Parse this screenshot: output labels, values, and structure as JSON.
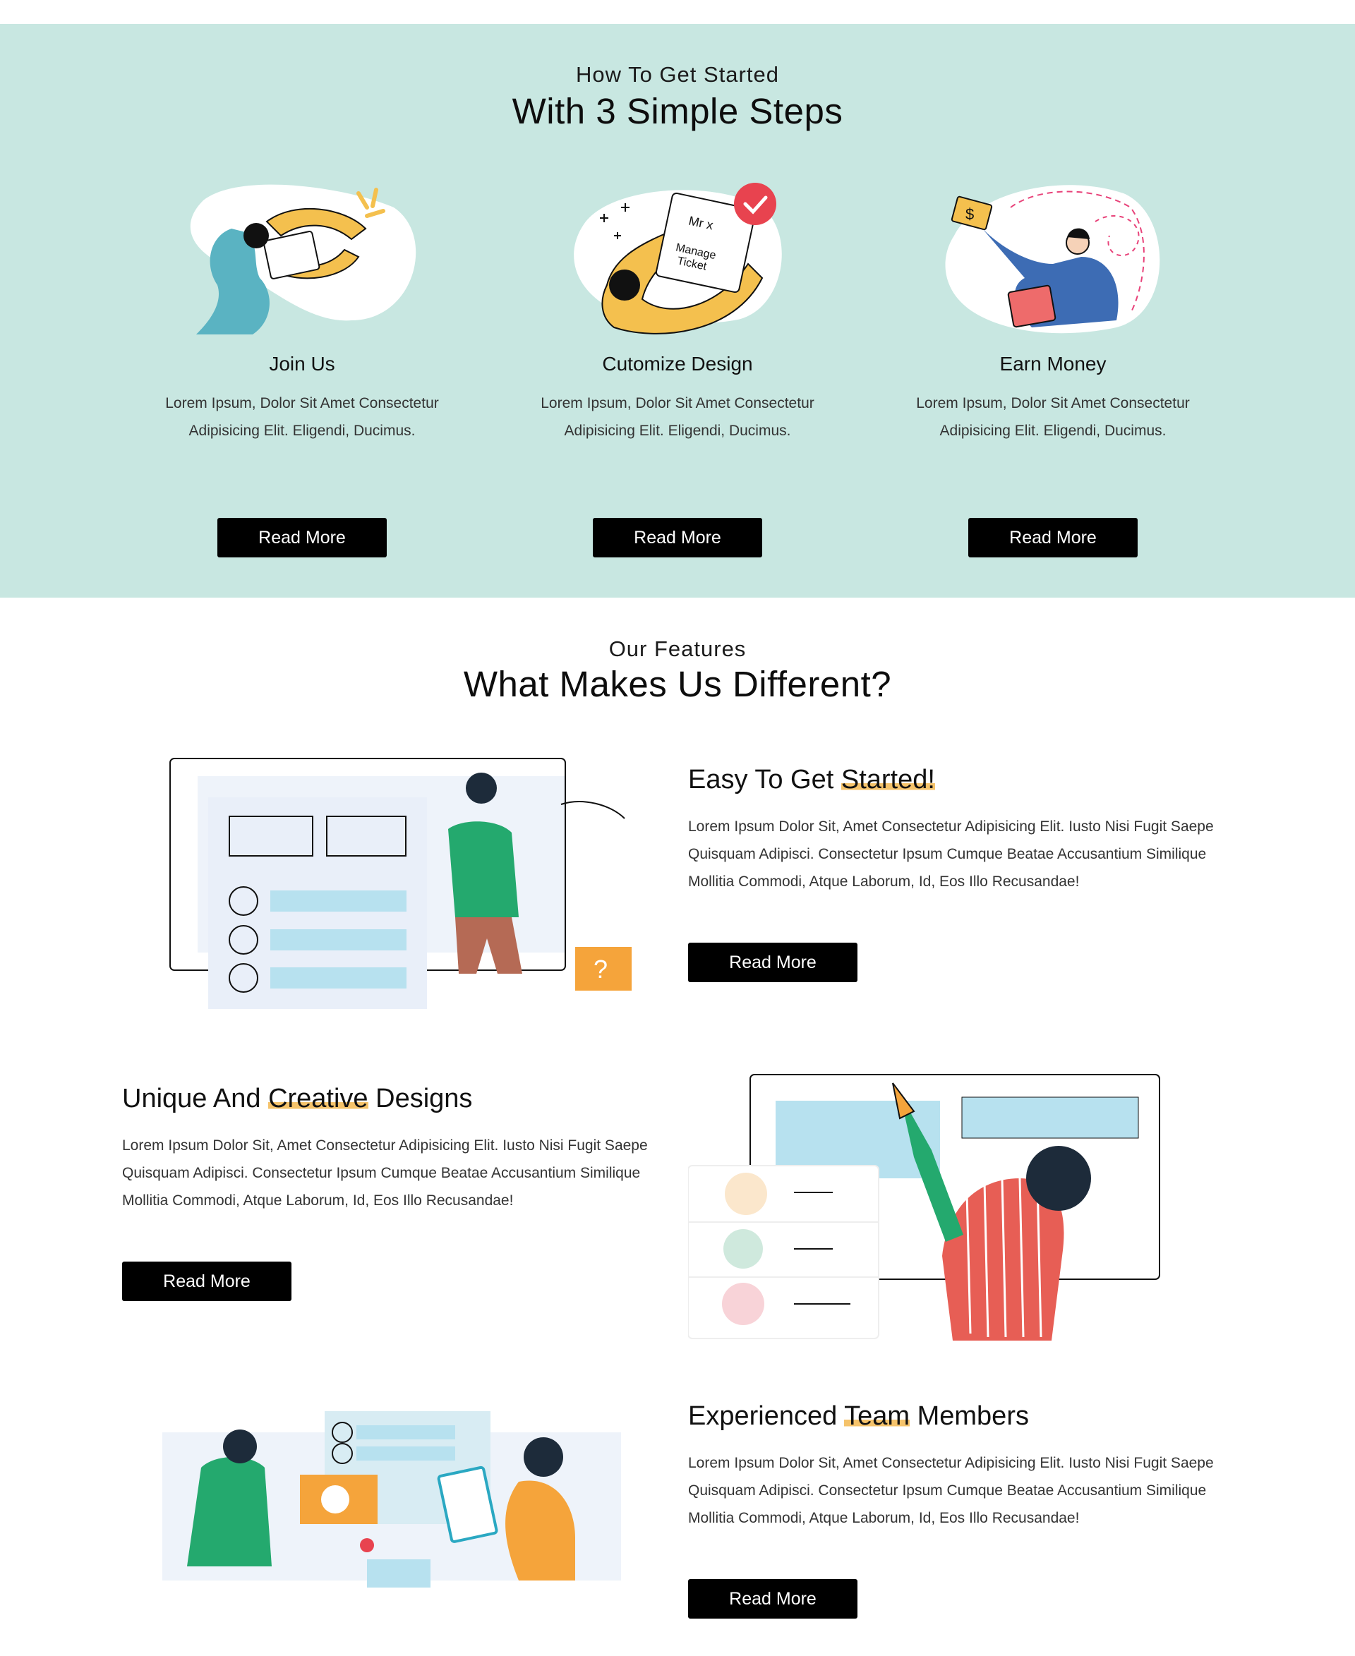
{
  "steps_section": {
    "kicker": "How To Get Started",
    "heading": "With 3 Simple Steps",
    "background": "#c8e7e1",
    "items": [
      {
        "title": "Join Us",
        "text": "Lorem Ipsum, Dolor Sit Amet Consectetur Adipisicing Elit. Eligendi, Ducimus.",
        "button": "Read More",
        "icon": "join-illustration"
      },
      {
        "title": "Cutomize Design",
        "text": "Lorem Ipsum, Dolor Sit Amet Consectetur Adipisicing Elit. Eligendi, Ducimus.",
        "button": "Read More",
        "icon": "ticket-illustration",
        "ticket_line1": "Mr x",
        "ticket_line2": "Manage",
        "ticket_line3": "Ticket"
      },
      {
        "title": "Earn Money",
        "text": "Lorem Ipsum, Dolor Sit Amet Consectetur Adipisicing Elit. Eligendi, Ducimus.",
        "button": "Read More",
        "icon": "money-illustration",
        "money_symbol": "$"
      }
    ]
  },
  "features_section": {
    "kicker": "Our Features",
    "heading": "What Makes Us Different?",
    "highlight_color": "#f5c36b",
    "items": [
      {
        "title_before": "Easy To Get ",
        "title_highlight": "Started!",
        "title_after": "",
        "text": "Lorem Ipsum Dolor Sit, Amet Consectetur Adipisicing Elit. Iusto Nisi Fugit Saepe Quisquam Adipisci. Consectetur Ipsum Cumque Beatae Accusantium Similique Mollitia Commodi, Atque Laborum, Id, Eos Illo Recusandae!",
        "button": "Read More",
        "badge": "?"
      },
      {
        "title_before": "Unique And ",
        "title_highlight": "Creative",
        "title_after": " Designs",
        "text": "Lorem Ipsum Dolor Sit, Amet Consectetur Adipisicing Elit. Iusto Nisi Fugit Saepe Quisquam Adipisci. Consectetur Ipsum Cumque Beatae Accusantium Similique Mollitia Commodi, Atque Laborum, Id, Eos Illo Recusandae!",
        "button": "Read More"
      },
      {
        "title_before": "Experienced ",
        "title_highlight": "Team",
        "title_after": " Members",
        "text": "Lorem Ipsum Dolor Sit, Amet Consectetur Adipisicing Elit. Iusto Nisi Fugit Saepe Quisquam Adipisci. Consectetur Ipsum Cumque Beatae Accusantium Similique Mollitia Commodi, Atque Laborum, Id, Eos Illo Recusandae!",
        "button": "Read More"
      }
    ]
  }
}
